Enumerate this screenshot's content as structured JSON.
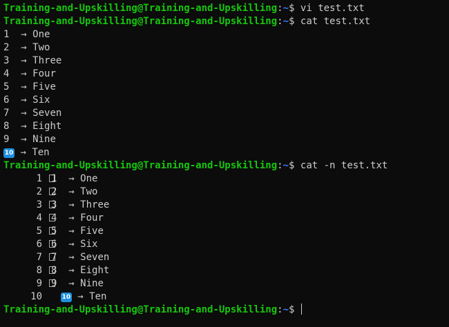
{
  "prompt": {
    "user_host": "Training-and-Upskilling@Training-and-Upskilling",
    "colon": ":",
    "path": "~",
    "dollar": "$"
  },
  "commands": {
    "vi": "vi test.txt",
    "cat": "cat test.txt",
    "cat_n": "cat -n test.txt"
  },
  "arrow": "→",
  "cat_output": [
    {
      "marker": "1",
      "word": "One"
    },
    {
      "marker": "2",
      "word": "Two"
    },
    {
      "marker": "3",
      "word": "Three"
    },
    {
      "marker": "4",
      "word": "Four"
    },
    {
      "marker": "5",
      "word": "Five"
    },
    {
      "marker": "6",
      "word": "Six"
    },
    {
      "marker": "7",
      "word": "Seven"
    },
    {
      "marker": "8",
      "word": "Eight"
    },
    {
      "marker": "9",
      "word": "Nine"
    },
    {
      "marker": "10",
      "word": "Ten"
    }
  ],
  "cat_n_output": [
    {
      "line_no": "1",
      "marker": "1",
      "word": "One"
    },
    {
      "line_no": "2",
      "marker": "2",
      "word": "Two"
    },
    {
      "line_no": "3",
      "marker": "3",
      "word": "Three"
    },
    {
      "line_no": "4",
      "marker": "4",
      "word": "Four"
    },
    {
      "line_no": "5",
      "marker": "5",
      "word": "Five"
    },
    {
      "line_no": "6",
      "marker": "6",
      "word": "Six"
    },
    {
      "line_no": "7",
      "marker": "7",
      "word": "Seven"
    },
    {
      "line_no": "8",
      "marker": "8",
      "word": "Eight"
    },
    {
      "line_no": "9",
      "marker": "9",
      "word": "Nine"
    },
    {
      "line_no": "10",
      "marker": "10",
      "word": "Ten"
    }
  ],
  "colors": {
    "background": "#0c0c0c",
    "foreground": "#cccccc",
    "prompt_user": "#16c60c",
    "prompt_path": "#3b78ff",
    "keycap": "#1e90e0"
  }
}
